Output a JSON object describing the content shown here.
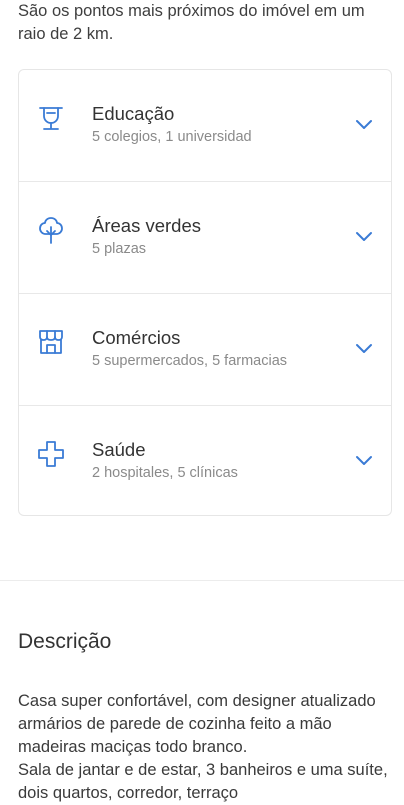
{
  "intro_text": "São os pontos mais próximos do imóvel em um raio de 2 km.",
  "colors": {
    "accent": "#3a7bd5"
  },
  "points": [
    {
      "icon": "school-icon",
      "title": "Educação",
      "subtitle": "5 colegios, 1 universidad"
    },
    {
      "icon": "tree-icon",
      "title": "Áreas verdes",
      "subtitle": "5 plazas"
    },
    {
      "icon": "store-icon",
      "title": "Comércios",
      "subtitle": "5 supermercados, 5 farmacias"
    },
    {
      "icon": "health-cross-icon",
      "title": "Saúde",
      "subtitle": "2 hospitales, 5 clínicas"
    }
  ],
  "description": {
    "title": "Descrição",
    "text": "Casa super confortável, com designer atualizado armários de parede de cozinha feito a mão madeiras maciças todo branco.\nSala de jantar e de estar, 3 banheiros e uma suíte, dois quartos, corredor, terraço"
  }
}
